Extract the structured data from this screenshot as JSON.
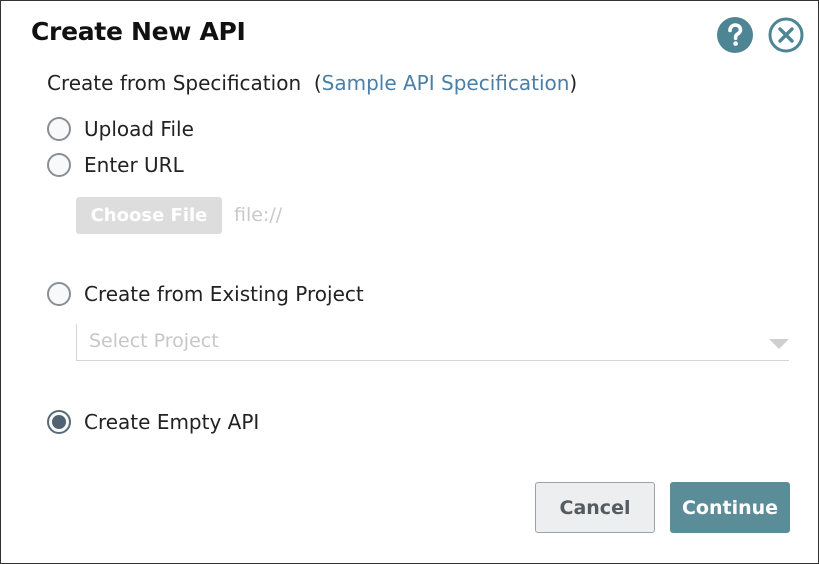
{
  "dialog": {
    "title": "Create New API",
    "help_icon": "question-mark-icon",
    "close_icon": "close-circle-icon"
  },
  "spec_section": {
    "label": "Create from Specification",
    "open_paren": "(",
    "link_text": "Sample API Specification",
    "close_paren": ")"
  },
  "options": {
    "upload_file": {
      "label": "Upload File",
      "checked": false
    },
    "enter_url": {
      "label": "Enter URL",
      "checked": false
    },
    "existing_project": {
      "label": "Create from Existing Project",
      "checked": false
    },
    "empty_api": {
      "label": "Create Empty API",
      "checked": true
    }
  },
  "file_input": {
    "button_label": "Choose File",
    "placeholder": "file://"
  },
  "project_select": {
    "placeholder": "Select Project"
  },
  "footer": {
    "cancel_label": "Cancel",
    "continue_label": "Continue"
  },
  "colors": {
    "accent": "#5b8d99",
    "help_icon_bg": "#4e8594",
    "link": "#4a7fa8"
  }
}
